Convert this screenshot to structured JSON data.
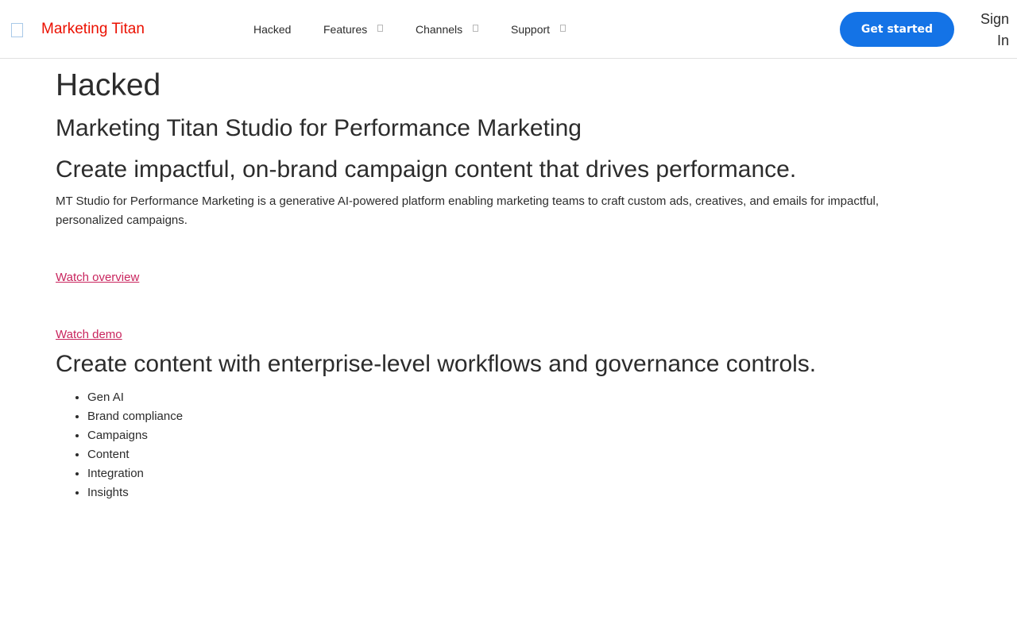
{
  "header": {
    "brand": "Marketing Titan",
    "nav": [
      {
        "label": "Hacked"
      },
      {
        "label": "Features"
      },
      {
        "label": "Channels"
      },
      {
        "label": "Support"
      }
    ],
    "cta_label": "Get started",
    "signin_label": "Sign In"
  },
  "main": {
    "page_title": "Hacked",
    "product_title": "Marketing Titan Studio for Performance Marketing",
    "headline": "Create impactful, on-brand campaign content that drives performance.",
    "description": "MT Studio for Performance Marketing is a generative   AI-powered platform enabling marketing teams to craft custom ads, creatives, and emails for impactful, personalized campaigns.",
    "watch_overview": "Watch overview",
    "watch_demo": "Watch demo",
    "section_title": "Create content with enterprise-level workflows and governance controls.",
    "features": [
      "Gen AI",
      "Brand compliance",
      "Campaigns",
      "Content",
      "Integration",
      "Insights"
    ]
  },
  "colors": {
    "brand": "#eb1000",
    "cta": "#1473e6",
    "link": "#c9255e"
  },
  "icons": {
    "logo": "logo-icon",
    "dropdown": "chevron-down-icon"
  }
}
